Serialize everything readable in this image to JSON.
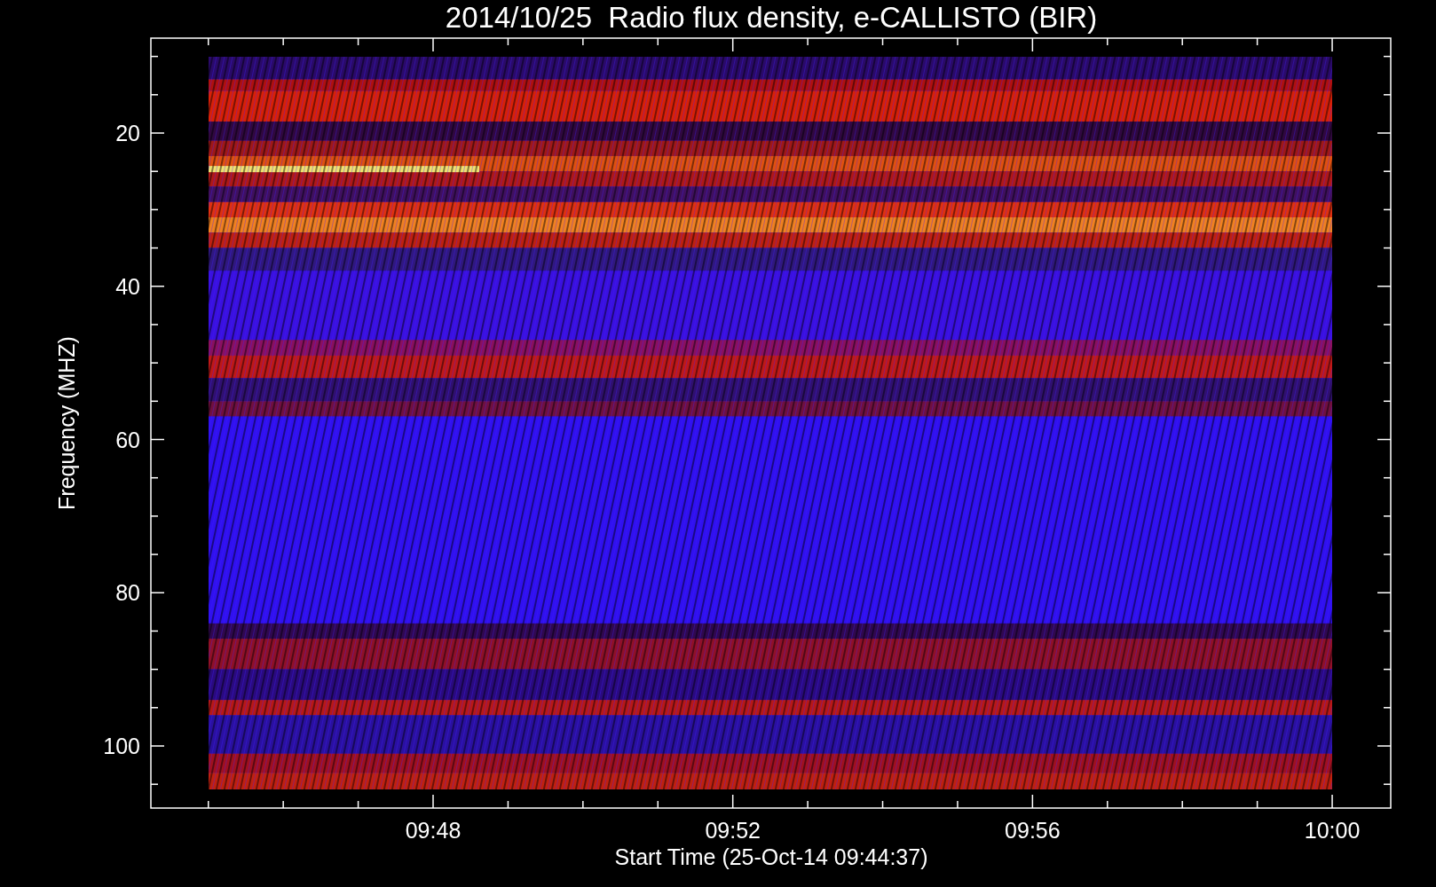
{
  "title": "2014/10/25  Radio flux density, e-CALLISTO (BIR)",
  "y_axis": {
    "label": "Frequency (MHZ)",
    "ticks": [
      "20",
      "40",
      "60",
      "80",
      "100"
    ]
  },
  "x_axis": {
    "label": "Start Time (25-Oct-14 09:44:37)",
    "ticks": [
      "09:48",
      "09:52",
      "09:56",
      "10:00"
    ]
  }
}
